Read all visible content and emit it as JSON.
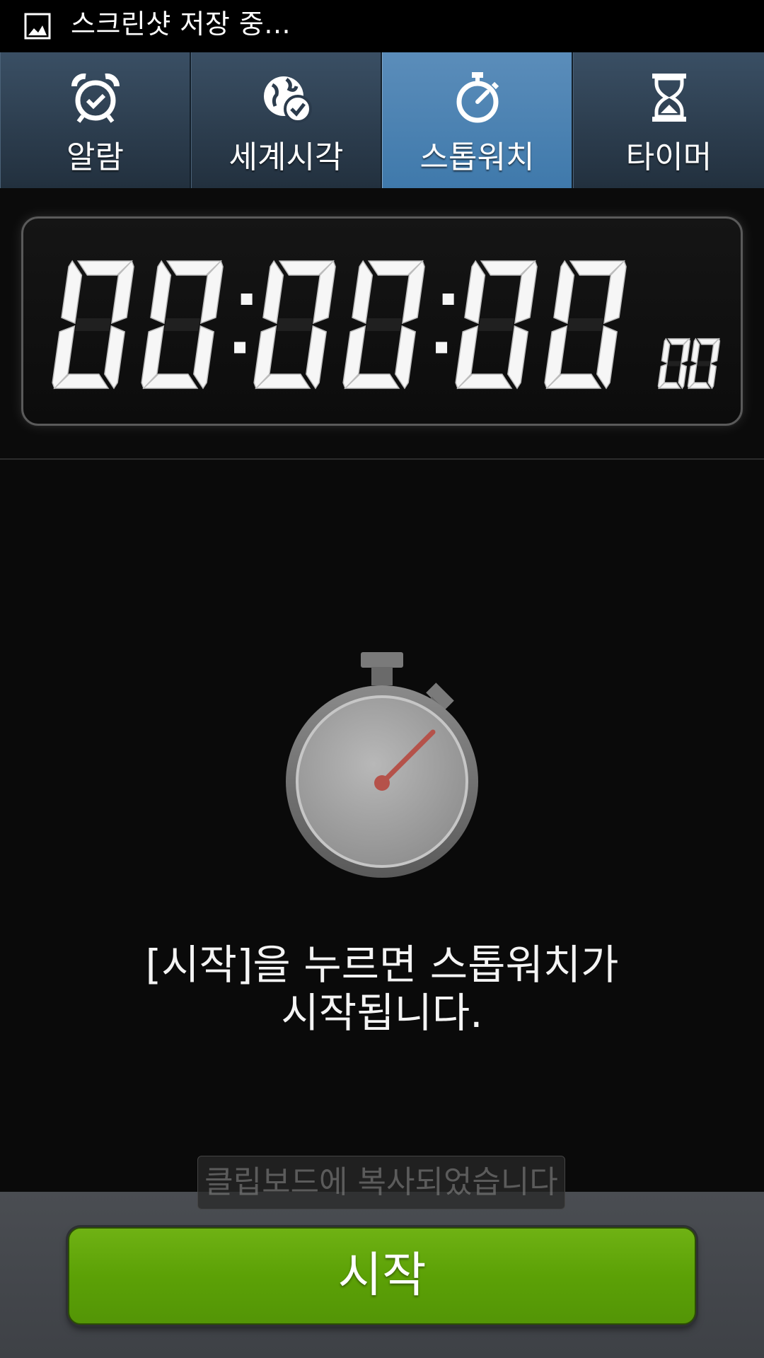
{
  "status_bar": {
    "text": "스크린샷 저장 중...",
    "icon": "image-icon"
  },
  "tabs": [
    {
      "label": "알람",
      "icon": "alarm-clock-icon",
      "active": false
    },
    {
      "label": "세계시각",
      "icon": "globe-icon",
      "active": false
    },
    {
      "label": "스톱워치",
      "icon": "stopwatch-icon",
      "active": true
    },
    {
      "label": "타이머",
      "icon": "hourglass-icon",
      "active": false
    }
  ],
  "display": {
    "hours": "00",
    "minutes": "00",
    "seconds": "00",
    "hundredths": "00"
  },
  "hint": {
    "line1": "[시작]을 누르면 스톱워치가",
    "line2": "시작됩니다."
  },
  "toast": "클립보드에 복사되었습니다",
  "actions": {
    "start_label": "시작"
  },
  "colors": {
    "active_tab": "#4a82b4",
    "start_button": "#5ca106",
    "needle": "#b5524a"
  }
}
